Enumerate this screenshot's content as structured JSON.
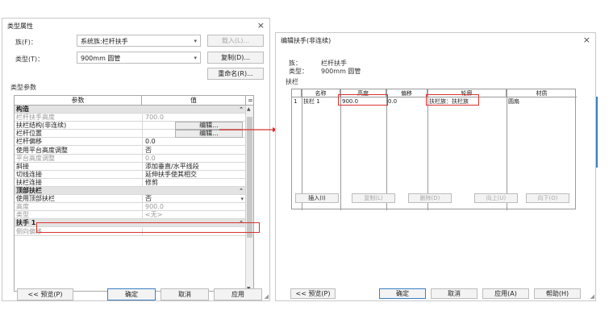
{
  "dialog1": {
    "title": "类型属性",
    "close": "×",
    "family_label": "族(F)：",
    "family_value": "系统族:栏杆扶手",
    "load_btn": "载入(L)...",
    "type_label": "类型(T)：",
    "type_value": "900mm 圆管",
    "duplicate_btn": "复制(D)...",
    "rename_btn": "重命名(R)...",
    "type_params_label": "类型参数",
    "col_param": "参数",
    "col_value": "值",
    "col_eq": "=",
    "rows": [
      {
        "name": "构造",
        "value": "",
        "group": true
      },
      {
        "name": "栏杆扶手高度",
        "value": "700.0",
        "dim": true
      },
      {
        "name": "扶栏结构(非连续)",
        "value": "编辑...",
        "button": true
      },
      {
        "name": "栏杆位置",
        "value": "编辑...",
        "button": true
      },
      {
        "name": "栏杆偏移",
        "value": "0.0"
      },
      {
        "name": "使用平台高度调整",
        "value": "否"
      },
      {
        "name": "平台高度调整",
        "value": "0.0",
        "dim": true
      },
      {
        "name": "斜接",
        "value": "添加垂直/水平线段"
      },
      {
        "name": "切线连接",
        "value": "延伸扶手使其相交"
      },
      {
        "name": "扶栏连接",
        "value": "修剪"
      },
      {
        "name": "顶部扶栏",
        "value": "",
        "group": true
      },
      {
        "name": "使用顶部扶栏",
        "value": "否"
      },
      {
        "name": "高度",
        "value": "900.0",
        "dim": true
      },
      {
        "name": "类型",
        "value": "<无>",
        "dim": true
      },
      {
        "name": "扶手 1",
        "value": "",
        "group": true
      },
      {
        "name": "侧向偏移",
        "value": "",
        "dim": true
      }
    ],
    "preview_btn": "<< 预览(P)",
    "ok_btn": "确定",
    "cancel_btn": "取消",
    "apply_btn": "应用"
  },
  "dialog2": {
    "title": "编辑扶手(非连续)",
    "close": "×",
    "family_label": "族：",
    "family_value": "栏杆扶手",
    "type_label": "类型：",
    "type_value": "900mm 圆管",
    "rails_label": "扶栏",
    "headers": [
      "名称",
      "高度",
      "偏移",
      "轮廓",
      "材质"
    ],
    "row": {
      "index": "1",
      "name": "扶栏 1",
      "height": "900.0",
      "offset": "0.0",
      "profile": "扶栏族：扶栏族",
      "material": "圆扇"
    },
    "insert_btn": "插入(I)",
    "copy_btn": "复制(L)",
    "delete_btn": "删除(D)",
    "up_btn": "向上(U)",
    "down_btn": "向下(O)",
    "preview_btn": "<< 预览(P)",
    "ok_btn": "确定",
    "cancel_btn": "取消",
    "apply_btn": "应用(A)",
    "help_btn": "帮助(H)"
  },
  "colors": {
    "highlight": "#d9322f",
    "accent": "#3c7fc4"
  }
}
